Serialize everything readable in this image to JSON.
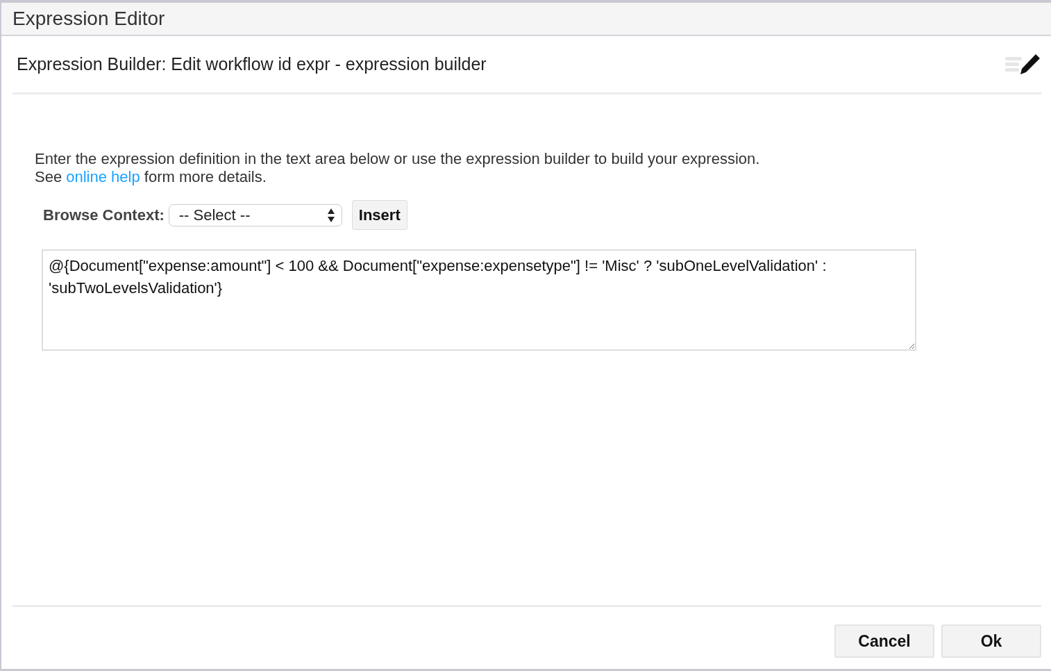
{
  "window": {
    "title": "Expression Editor"
  },
  "header": {
    "title": "Expression Builder: Edit workflow id expr - expression builder"
  },
  "intro": {
    "line1": "Enter the expression definition in the text area below or use the expression builder to build your expression.",
    "before_link": "See",
    "link": "online help",
    "after_link": "form more details."
  },
  "browse": {
    "label": "Browse Context:",
    "select_value": "-- Select --",
    "insert_button": "Insert"
  },
  "expression": {
    "value": "@{Document[\"expense:amount\"] < 100 && Document[\"expense:expensetype\"] != 'Misc' ? 'subOneLevelValidation' : 'subTwoLevelsValidation'}"
  },
  "buttons": [
    "Cancel",
    "Ok"
  ]
}
